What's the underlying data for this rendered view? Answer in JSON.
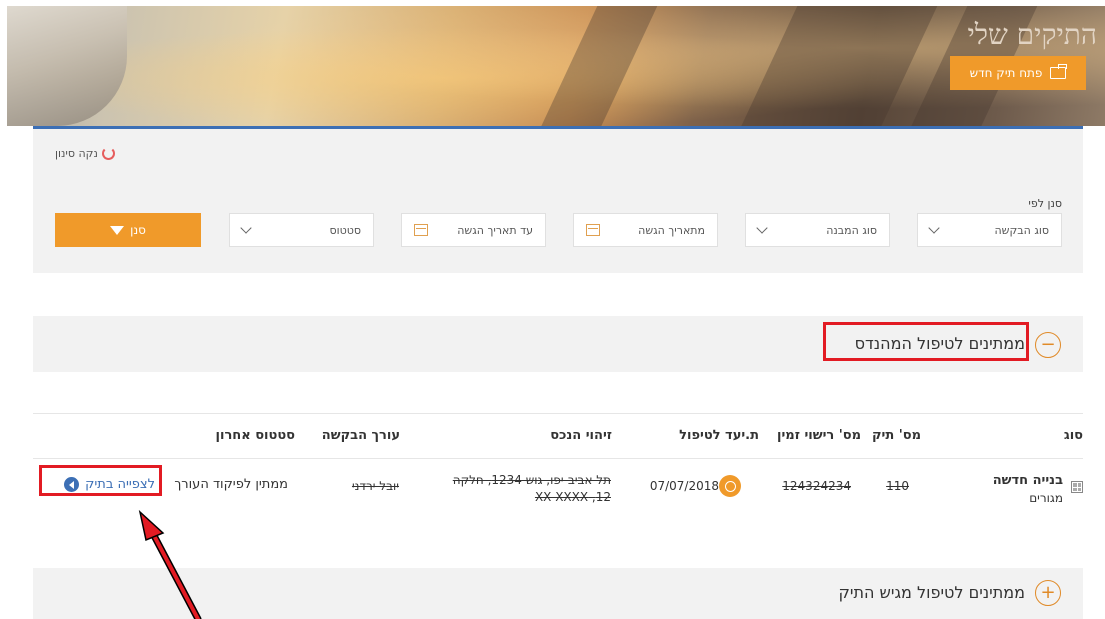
{
  "banner": {
    "title": "התיקים שלי",
    "new_case_label": "פתח תיק חדש"
  },
  "filters": {
    "clear_label": "נקה סינון",
    "filter_by_label": "סנן לפי",
    "request_type": "סוג הבקשה",
    "building_type": "סוג המבנה",
    "from_date": "מתאריך הגשה",
    "to_date": "עד תאריך הגשה",
    "status": "סטטוס",
    "filter_button": "סנן"
  },
  "section_engineer": {
    "title": "ממתינים לטיפול המהנדס"
  },
  "table": {
    "headers": {
      "type": "סוג",
      "case_no": "מס' תיק",
      "permit_no": "מס' רישוי זמין",
      "due_date": "ת.יעד לטיפול",
      "asset_id": "זיהוי הנכס",
      "editor": "עורך הבקשה",
      "last_status": "סטטוס אחרון"
    },
    "rows": [
      {
        "type_main": "בנייה חדשה",
        "type_sub": "מגורים",
        "case_no": "110",
        "permit_no": "124324234",
        "due_date": "07/07/2018",
        "asset_line1": "תל אביב-יפו, גוש 1234, חלקה",
        "asset_line2": "12, XX XXXX",
        "editor": "יובל ירדני",
        "last_status": "ממתין לפיקוד העורך",
        "view_link": "לצפייה בתיק"
      }
    ]
  },
  "section_submitter": {
    "title": "ממתינים לטיפול מגיש התיק"
  },
  "colors": {
    "accent": "#f09a2a",
    "link": "#3c6fb5",
    "annotation": "#e21b23"
  }
}
